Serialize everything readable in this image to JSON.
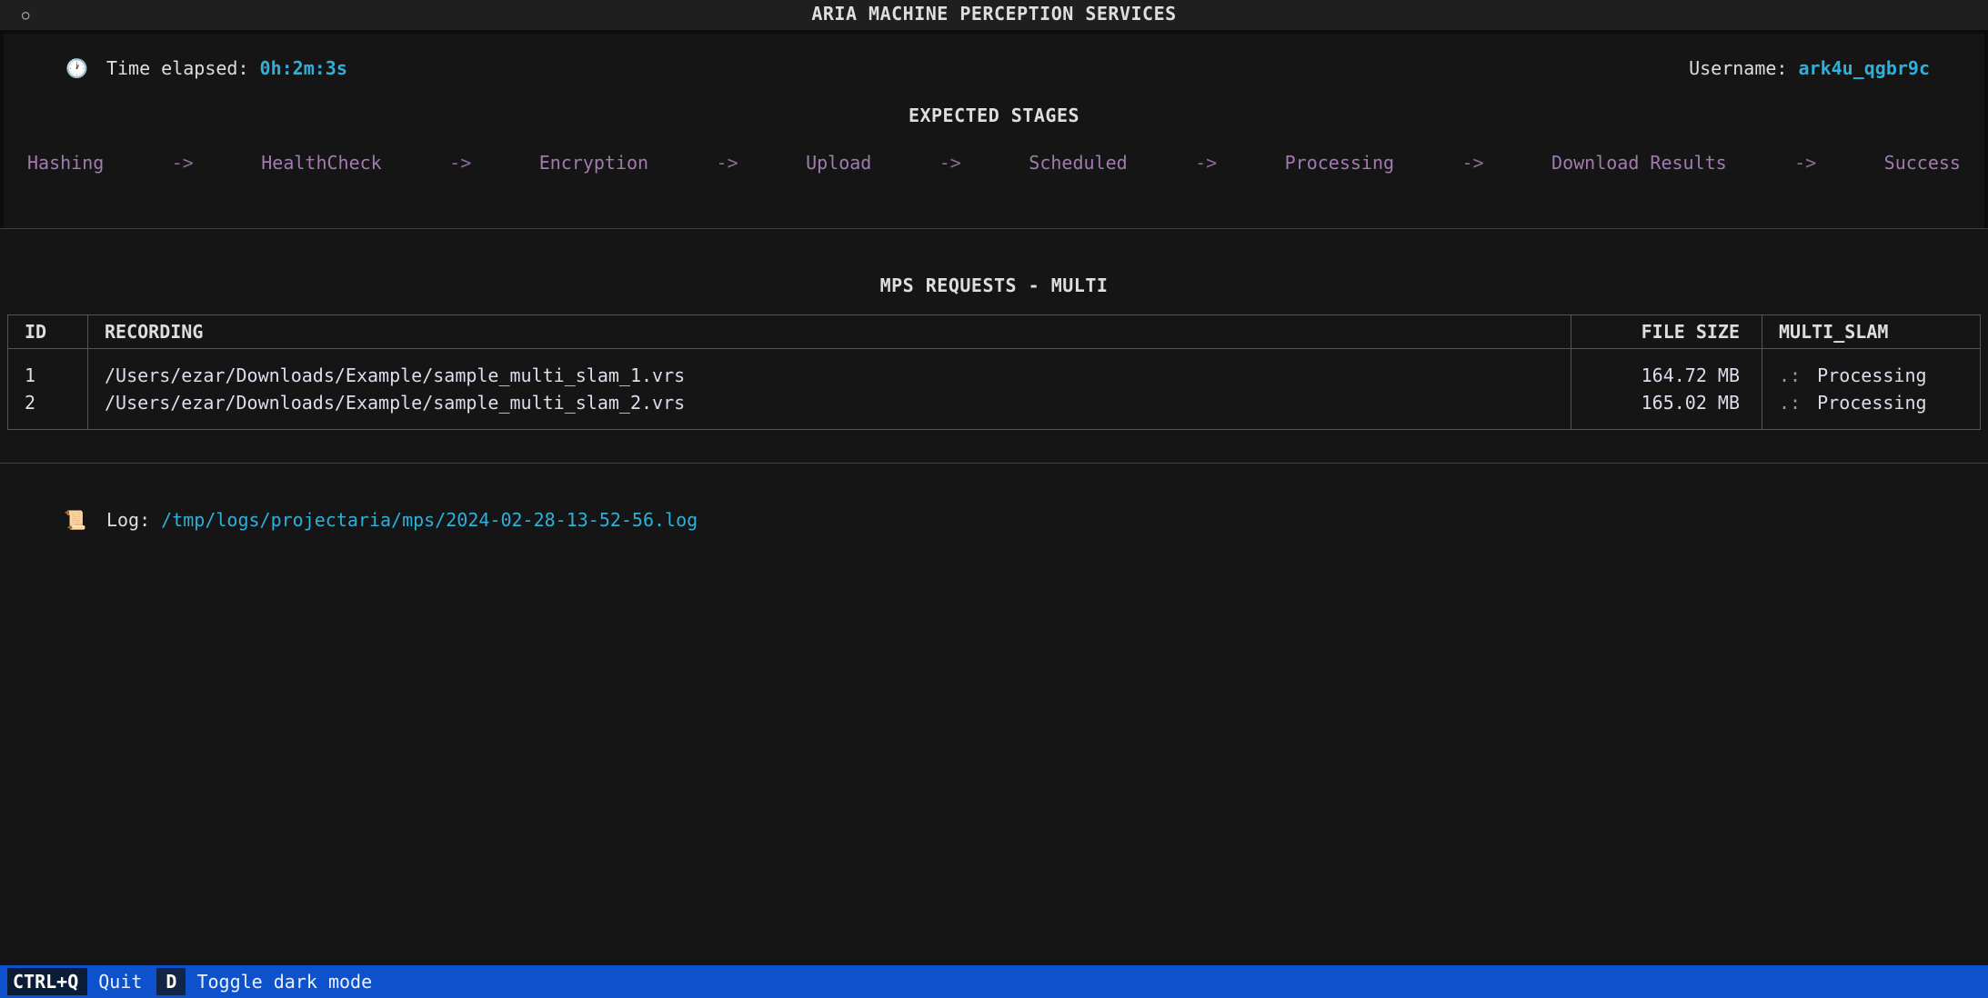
{
  "title": "ARIA MACHINE PERCEPTION SERVICES",
  "header": {
    "timer_icon": "🕐",
    "timer_label": "Time elapsed: ",
    "timer_value": "0h:2m:3s",
    "user_label": "Username: ",
    "user_value": "ark4u_qgbr9c"
  },
  "stages_title": "EXPECTED STAGES",
  "stages": [
    "Hashing",
    "HealthCheck",
    "Encryption",
    "Upload",
    "Scheduled",
    "Processing",
    "Download Results",
    "Success"
  ],
  "arrow": "->",
  "requests_title": "MPS REQUESTS - MULTI",
  "columns": {
    "id": "ID",
    "recording": "RECORDING",
    "size": "FILE SIZE",
    "status": "MULTI_SLAM"
  },
  "rows": [
    {
      "id": "1",
      "recording": "/Users/ezar/Downloads/Example/sample_multi_slam_1.vrs",
      "size": "164.72 MB",
      "spinner": ".:",
      "status": "Processing"
    },
    {
      "id": "2",
      "recording": "/Users/ezar/Downloads/Example/sample_multi_slam_2.vrs",
      "size": "165.02 MB",
      "spinner": ".:",
      "status": "Processing"
    }
  ],
  "log": {
    "icon": "📜",
    "label": "Log: ",
    "path": "/tmp/logs/projectaria/mps/2024-02-28-13-52-56.log"
  },
  "footer": [
    {
      "key": "CTRL+Q",
      "desc": "Quit"
    },
    {
      "key": "D",
      "desc": "Toggle dark mode"
    }
  ]
}
